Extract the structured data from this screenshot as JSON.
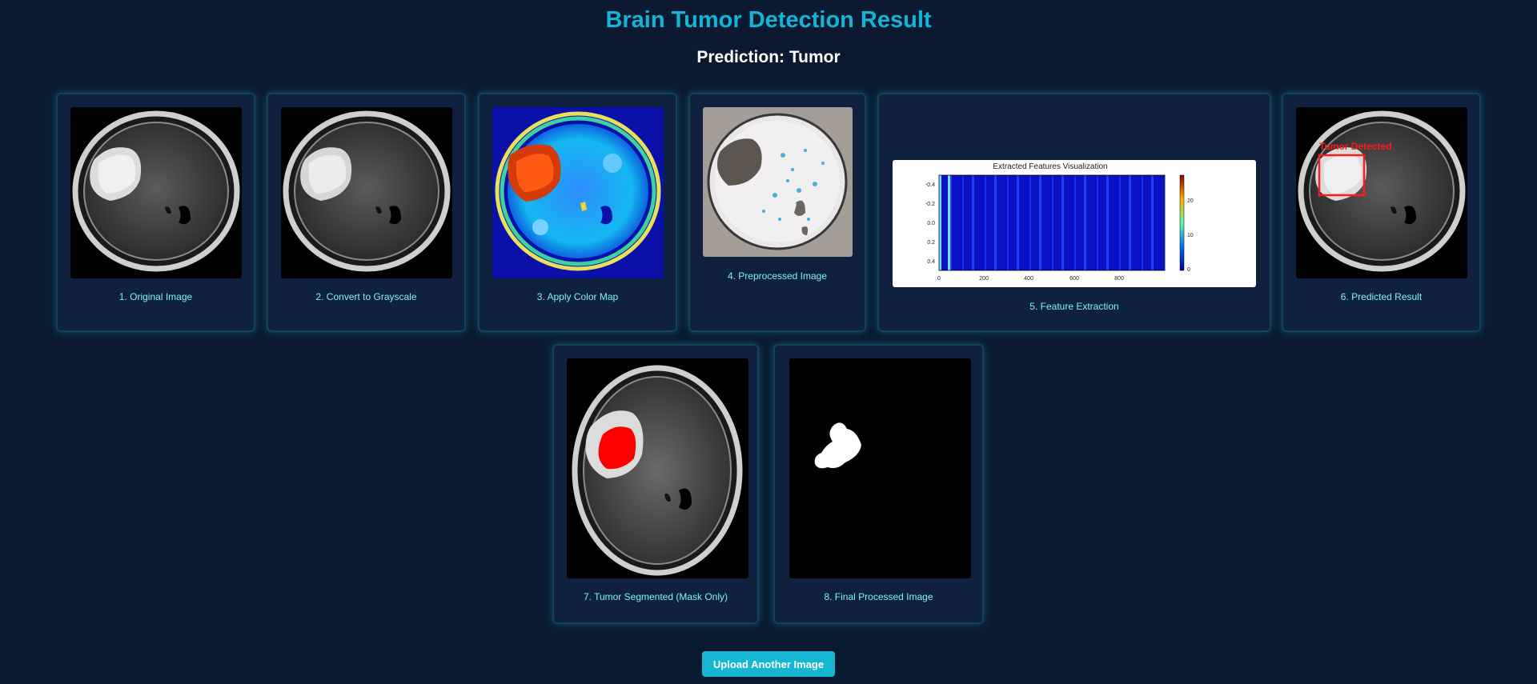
{
  "page": {
    "title": "Brain Tumor Detection Result",
    "prediction": "Prediction: Tumor"
  },
  "steps": [
    {
      "caption": "1. Original Image"
    },
    {
      "caption": "2. Convert to Grayscale"
    },
    {
      "caption": "3. Apply Color Map"
    },
    {
      "caption": "4. Preprocessed Image"
    },
    {
      "caption": "5. Feature Extraction"
    },
    {
      "caption": "6. Predicted Result"
    },
    {
      "caption": "7. Tumor Segmented (Mask Only)"
    },
    {
      "caption": "8. Final Processed Image"
    }
  ],
  "feature_plot": {
    "title": "Extracted Features Visualization",
    "y_ticks": [
      "-0.4",
      "-0.2",
      "0.0",
      "0.2",
      "0.4"
    ],
    "x_ticks": [
      "0",
      "200",
      "400",
      "600",
      "800"
    ],
    "colorbar_ticks": [
      "20",
      "10",
      "0"
    ]
  },
  "predicted_overlay": {
    "label": "Tumor Detected",
    "color": "#ff1a1a"
  },
  "actions": {
    "upload_label": "Upload Another Image"
  },
  "colors": {
    "background": "#0b1a30",
    "title": "#13b5d6",
    "caption": "#7ff3ea",
    "card": "#10213f",
    "button": "#14b6d2"
  }
}
